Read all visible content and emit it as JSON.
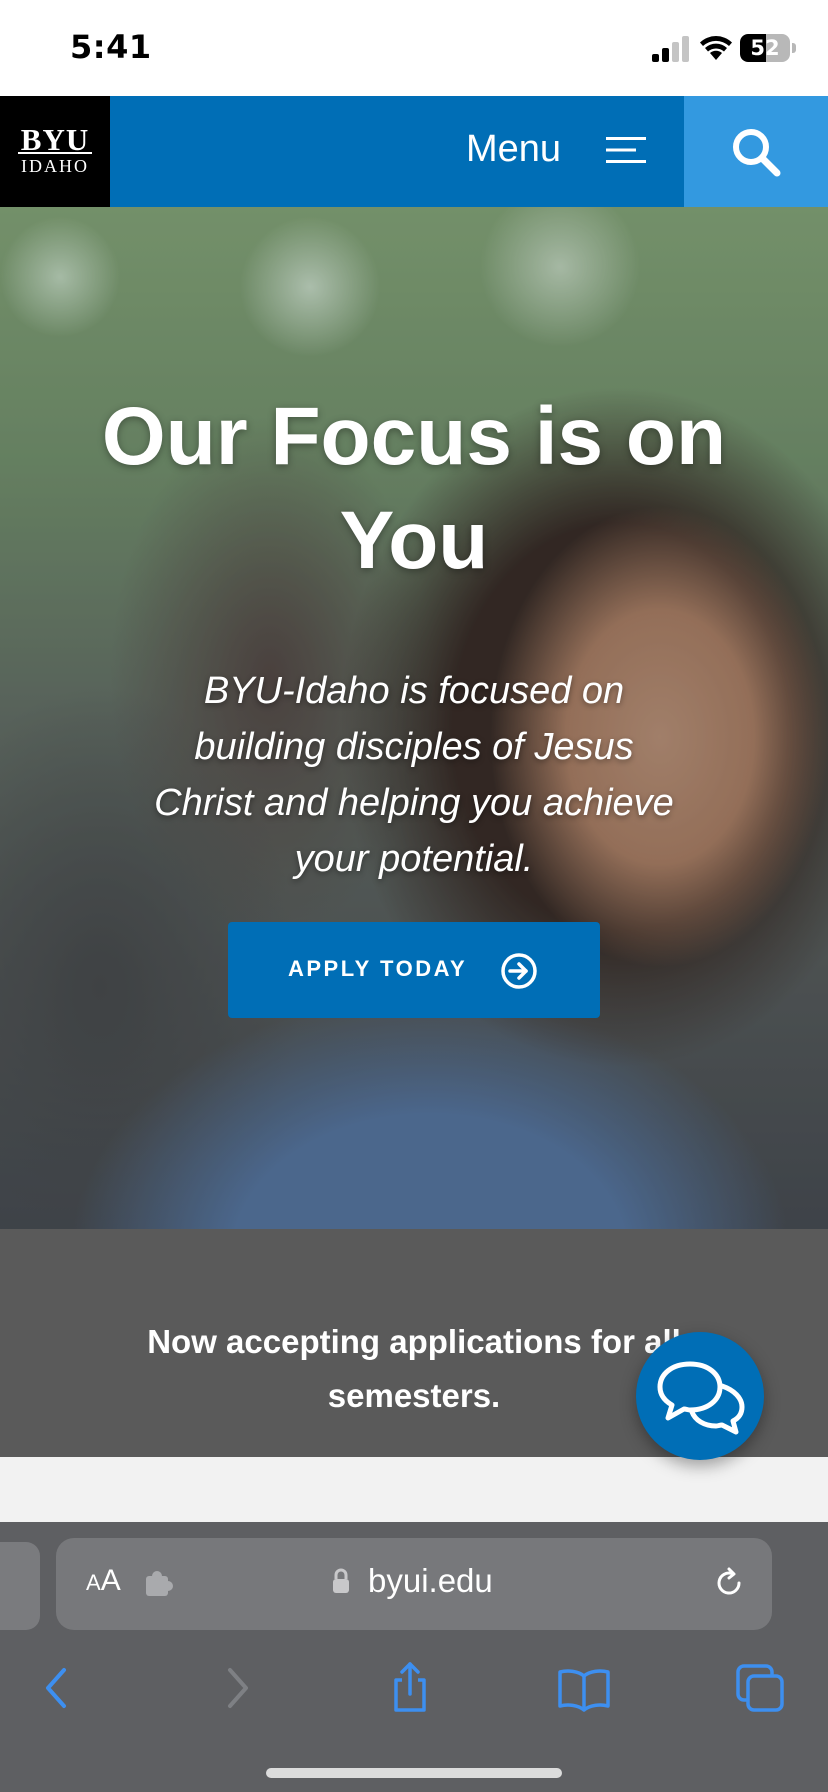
{
  "status_bar": {
    "time": "5:41",
    "battery_percent": "52",
    "battery_level": 0.52
  },
  "header": {
    "logo_top": "BYU",
    "logo_bottom": "IDAHO",
    "menu_label": "Menu"
  },
  "hero": {
    "title": "Our Focus is on You",
    "subtitle": "BYU-Idaho is focused on building disciples of Jesus Christ and helping you achieve your potential.",
    "cta_label": "APPLY TODAY"
  },
  "banner": {
    "text": "Now accepting applications for all semesters."
  },
  "browser": {
    "aa_small": "A",
    "aa_large": "A",
    "url": "byui.edu"
  },
  "colors": {
    "brand_blue": "#006eb6",
    "search_blue": "#3399e0",
    "banner_gray": "#5a5a5a",
    "safari_blue": "#3d8ff0"
  },
  "icons": [
    "hamburger-icon",
    "search-icon",
    "arrow-circle-icon",
    "chat-icon",
    "extension-icon",
    "lock-icon",
    "reload-icon",
    "back-icon",
    "forward-icon",
    "share-icon",
    "bookmarks-icon",
    "tabs-icon"
  ]
}
